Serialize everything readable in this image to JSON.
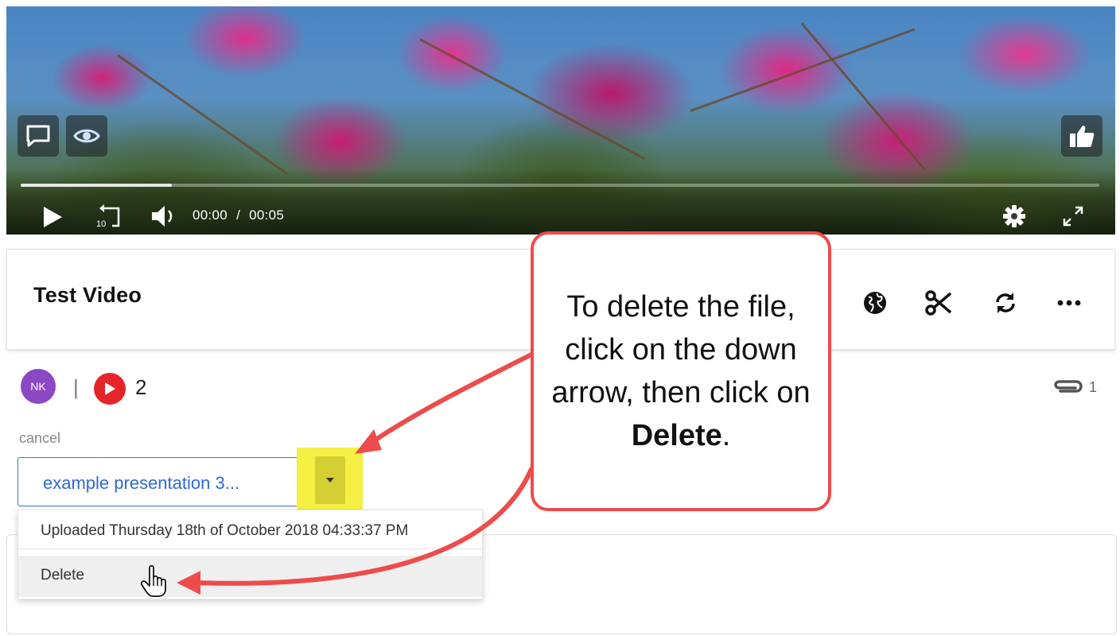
{
  "video": {
    "time_current": "00:00",
    "time_separator": "/",
    "time_total": "00:05",
    "progress_fraction": 0.14,
    "icons": [
      "comment-icon",
      "eye-icon",
      "thumbs-up-icon",
      "play-icon",
      "rewind-10-icon",
      "volume-icon",
      "settings-icon",
      "fullscreen-icon"
    ]
  },
  "media": {
    "title": "Test Video",
    "actions": [
      "globe-icon",
      "scissors-icon",
      "refresh-icon",
      "more-icon"
    ]
  },
  "meta": {
    "avatar_initials": "NK",
    "separator": "|",
    "play_count": "2",
    "attachment_count": "1"
  },
  "attachment": {
    "cancel_label": "cancel",
    "file_name": "example presentation   3...",
    "menu": {
      "uploaded_text": "Uploaded Thursday 18th of October 2018 04:33:37 PM",
      "delete_label": "Delete"
    }
  },
  "callout": {
    "text_before": "To delete the file, click on the down arrow, then click on ",
    "text_bold": "Delete",
    "text_after": "."
  },
  "colors": {
    "accent_blue": "#2f68d8",
    "highlight_yellow": "#f5f043",
    "callout_red": "#ee4b4b",
    "play_badge_red": "#e5252a",
    "avatar_purple": "#8c47c4"
  }
}
